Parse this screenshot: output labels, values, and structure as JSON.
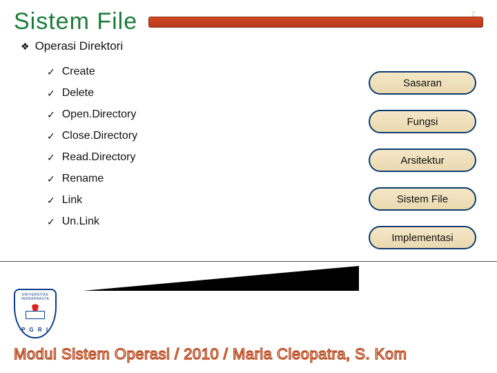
{
  "page_number": "7",
  "title": "Sistem File",
  "subheading": "Operasi Direktori",
  "operations": [
    "Create",
    "Delete",
    "Open.Directory",
    "Close.Directory",
    "Read.Directory",
    "Rename",
    "Link",
    "Un.Link"
  ],
  "nav": {
    "items": [
      "Sasaran",
      "Fungsi",
      "Arsitektur",
      "Sistem File",
      "Implementasi"
    ]
  },
  "logo": {
    "top_text": "UNIVERSITAS INDRAPRASTA",
    "acronym": "P G R I"
  },
  "footer": "Modul Sistem Operasi / 2010 / Maria Cleopatra, S. Kom",
  "colors": {
    "title": "#1b7a3a",
    "bar": "#c5421e",
    "nav_border": "#0a3a6a",
    "nav_fill": "#ecdcb6",
    "footer_stroke": "#b9481f"
  }
}
